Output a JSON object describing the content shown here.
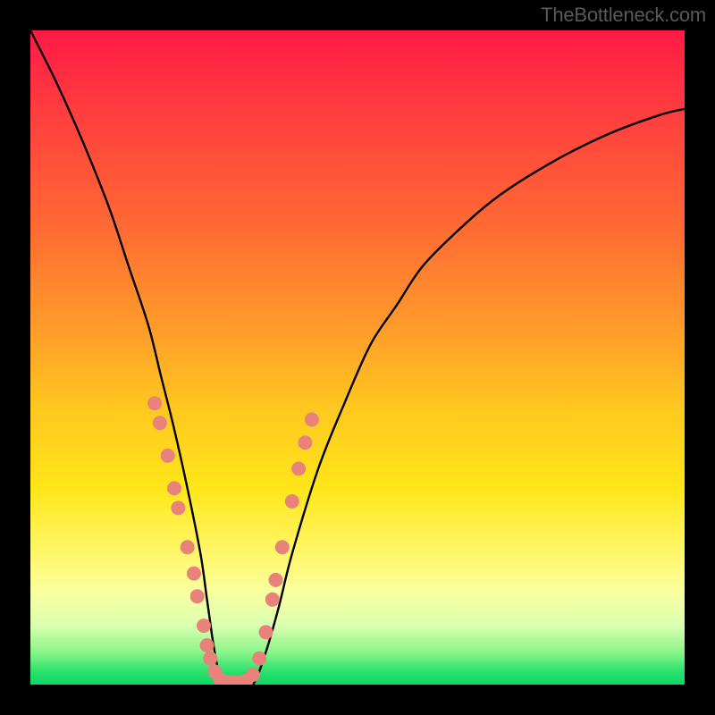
{
  "watermark": "TheBottleneck.com",
  "chart_data": {
    "type": "line",
    "title": "",
    "xlabel": "",
    "ylabel": "",
    "xlim": [
      0,
      100
    ],
    "ylim": [
      0,
      100
    ],
    "annotations": [],
    "series": [
      {
        "name": "bottleneck-curve",
        "x": [
          0,
          4,
          8,
          12,
          15,
          18,
          20,
          22,
          24,
          26,
          27,
          28,
          29,
          30,
          32,
          34,
          36,
          38,
          40,
          44,
          48,
          52,
          56,
          60,
          66,
          72,
          80,
          88,
          96,
          100
        ],
        "y": [
          100,
          92,
          83,
          73,
          64,
          55,
          47,
          39,
          30,
          20,
          13,
          6,
          1,
          0,
          0,
          0,
          5,
          12,
          20,
          33,
          43,
          52,
          58,
          64,
          70,
          75,
          80,
          84,
          87,
          88
        ]
      }
    ],
    "markers": {
      "name": "sample-dots",
      "color": "#e8827b",
      "points": [
        {
          "x": 19.0,
          "y": 43.0
        },
        {
          "x": 19.8,
          "y": 40.0
        },
        {
          "x": 21.0,
          "y": 35.0
        },
        {
          "x": 22.0,
          "y": 30.0
        },
        {
          "x": 22.6,
          "y": 27.0
        },
        {
          "x": 24.0,
          "y": 21.0
        },
        {
          "x": 25.0,
          "y": 17.0
        },
        {
          "x": 25.5,
          "y": 13.5
        },
        {
          "x": 26.5,
          "y": 9.0
        },
        {
          "x": 27.0,
          "y": 6.0
        },
        {
          "x": 27.5,
          "y": 4.0
        },
        {
          "x": 28.2,
          "y": 2.0
        },
        {
          "x": 29.0,
          "y": 0.8
        },
        {
          "x": 30.0,
          "y": 0.4
        },
        {
          "x": 31.0,
          "y": 0.3
        },
        {
          "x": 32.0,
          "y": 0.3
        },
        {
          "x": 33.0,
          "y": 0.6
        },
        {
          "x": 34.0,
          "y": 1.5
        },
        {
          "x": 35.0,
          "y": 4.0
        },
        {
          "x": 36.0,
          "y": 8.0
        },
        {
          "x": 37.0,
          "y": 13.0
        },
        {
          "x": 37.5,
          "y": 16.0
        },
        {
          "x": 38.5,
          "y": 21.0
        },
        {
          "x": 40.0,
          "y": 28.0
        },
        {
          "x": 41.0,
          "y": 33.0
        },
        {
          "x": 42.0,
          "y": 37.0
        },
        {
          "x": 43.0,
          "y": 40.5
        }
      ]
    }
  }
}
